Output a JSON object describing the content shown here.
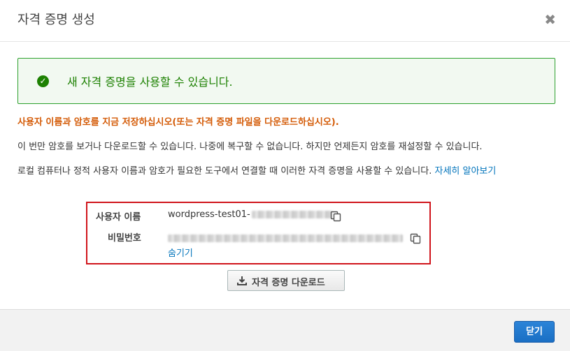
{
  "header": {
    "title": "자격 증명 생성",
    "close_symbol": "✖"
  },
  "success": {
    "icon": "check-circle-icon",
    "message": "새 자격 증명을 사용할 수 있습니다."
  },
  "warning": "사용자 이름과 암호를 지금 저장하십시오(또는 자격 증명 파일을 다운로드하십시오).",
  "info": {
    "line1": "이 번만 암호를 보거나 다운로드할 수 있습니다. 나중에 복구할 수 없습니다. 하지만 언제든지 암호를 재설정할 수 있습니다.",
    "line2": "로컬 컴퓨터나 정적 사용자 이름과 암호가 필요한 도구에서 연결할 때 이러한 자격 증명을 사용할 수 있습니다.",
    "learn_more": "자세히 알아보기"
  },
  "credentials": {
    "username_label": "사용자 이름",
    "username_value": "wordpress-test01-",
    "password_label": "비밀번호",
    "hide_link": "숨기기"
  },
  "download_button": "자격 증명 다운로드",
  "footer": {
    "close_button": "닫기"
  },
  "colors": {
    "success": "#1d8102",
    "warning": "#d45b07",
    "link": "#0073bb",
    "highlight_border": "#d0141b",
    "primary": "#1a6fc4"
  }
}
